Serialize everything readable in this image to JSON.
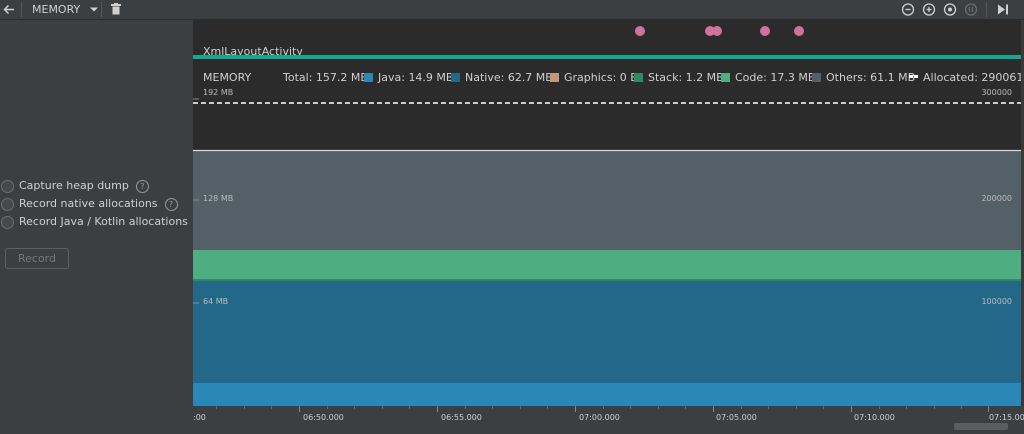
{
  "toolbar": {
    "profiler_select": "MEMORY"
  },
  "options": [
    {
      "label": "Capture heap dump"
    },
    {
      "label": "Record native allocations"
    },
    {
      "label": "Record Java / Kotlin allocations"
    }
  ],
  "record_button": "Record",
  "activity": {
    "label": "XmlLayoutActivity"
  },
  "legend": {
    "title": "MEMORY",
    "total": "Total: 157.2 MB",
    "items": [
      {
        "label": "Java: 14.9 MB",
        "color": "#2b87b8"
      },
      {
        "label": "Native: 62.7 MB",
        "color": "#236889"
      },
      {
        "label": "Graphics: 0 B",
        "color": "#c4967a"
      },
      {
        "label": "Stack: 1.2 MB",
        "color": "#2f8a64"
      },
      {
        "label": "Code: 17.3 MB",
        "color": "#4fae81"
      },
      {
        "label": "Others: 61.1 MB",
        "color": "#536068"
      }
    ],
    "allocated": "Allocated: 290061"
  },
  "axis_left": [
    "192 MB",
    "128 MB",
    "64 MB"
  ],
  "axis_right": [
    "300000",
    "200000",
    "100000"
  ],
  "time_labels": [
    ":00",
    "06:50.000",
    "06:55.000",
    "07:00.000",
    "07:05.000",
    "07:10.000",
    "07:15.00"
  ],
  "colors": {
    "java": "#2b87b8",
    "native": "#236889",
    "code": "#4fae81",
    "others": "#536068",
    "event_dot": "#d0729b",
    "activity_bar": "#12a894"
  }
}
